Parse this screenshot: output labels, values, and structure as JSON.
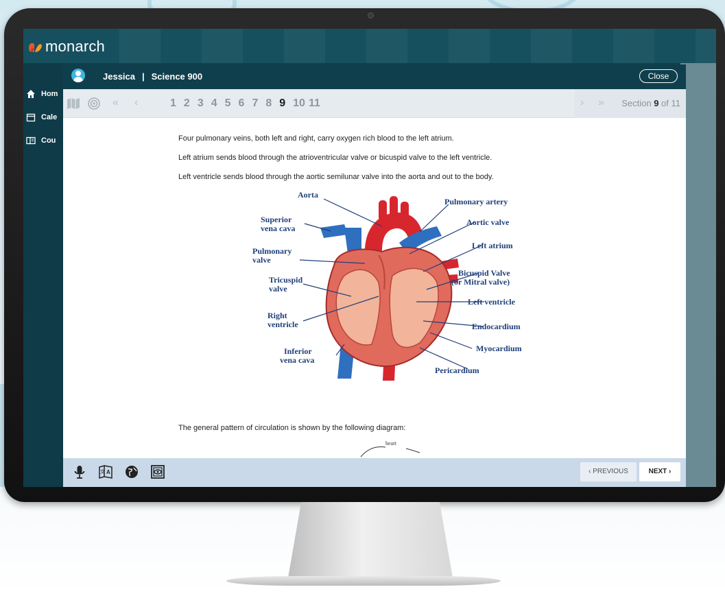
{
  "app": {
    "logo_text": "monarch"
  },
  "sidebar": {
    "items": [
      {
        "label": "Hom",
        "icon": "home-icon"
      },
      {
        "label": "Cale",
        "icon": "calendar-icon"
      },
      {
        "label": "Cou",
        "icon": "book-icon"
      }
    ]
  },
  "modal": {
    "user_name": "Jessica",
    "separator": "|",
    "course": "Science 900",
    "close_label": "Close"
  },
  "navbar": {
    "pages": [
      "1",
      "2",
      "3",
      "4",
      "5",
      "6",
      "7",
      "8",
      "9",
      "10",
      "11"
    ],
    "current_page": "9",
    "section_prefix": "Section",
    "section_current": "9",
    "section_suffix": "of 11"
  },
  "content": {
    "paragraphs": [
      "Four pulmonary veins, both left and right, carry oxygen rich blood to the left atrium.",
      "Left atrium sends blood through the atrioventricular valve or bicuspid valve to the left ventricle.",
      "Left ventricle sends blood through the aortic semilunar valve into the aorta and out to the body."
    ],
    "diagram_labels": {
      "aorta": "Aorta",
      "pulmonary_artery": "Pulmonary artery",
      "superior_vena_cava_1": "Superior",
      "superior_vena_cava_2": "vena cava",
      "aortic_valve": "Aortic valve",
      "pulmonary_valve_1": "Pulmonary",
      "pulmonary_valve_2": "valve",
      "left_atrium": "Left atrium",
      "tricuspid_1": "Tricuspid",
      "tricuspid_2": "valve",
      "bicuspid_1": "Bicuspid Valve",
      "bicuspid_2": "(or Mitral valve)",
      "left_ventricle": "Left ventricle",
      "right_ventricle_1": "Right",
      "right_ventricle_2": "ventricle",
      "endocardium": "Endocardium",
      "myocardium": "Myocardium",
      "inferior_vena_cava_1": "Inferior",
      "inferior_vena_cava_2": "vena cava",
      "pericardium": "Pericardium"
    },
    "circulation_text": "The general pattern of circulation is shown by the following diagram:",
    "circulation_hint": "heart"
  },
  "footer": {
    "tools": [
      "microphone-icon",
      "translate-icon",
      "globe-icon",
      "screen-mask-icon"
    ],
    "prev_label": "‹ PREVIOUS",
    "next_label": "NEXT ›"
  },
  "colors": {
    "title_bar": "#0f3f4c",
    "nav_bg": "#e6ebef",
    "footer_bg": "#c9d9e9",
    "accent_blue": "#3fb6e0"
  }
}
